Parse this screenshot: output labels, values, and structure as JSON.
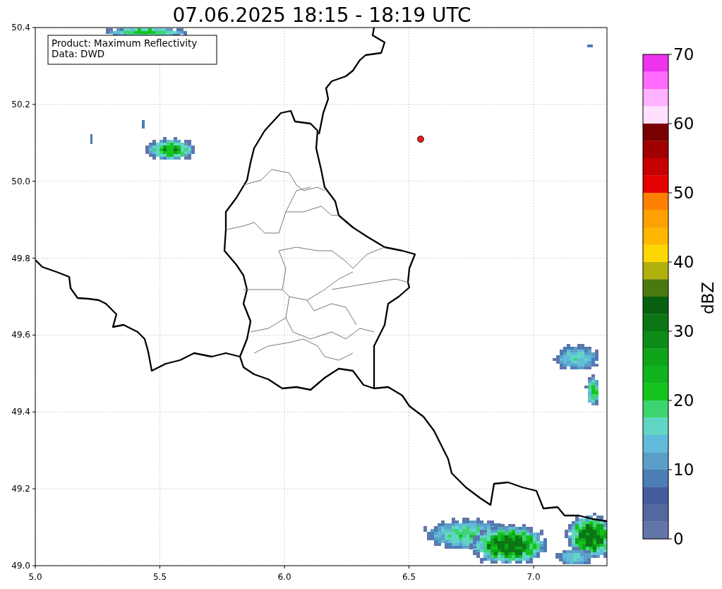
{
  "title": "07.06.2025 18:15 - 18:19 UTC",
  "info_box": {
    "lines": [
      "Product: Maximum Reflectivity",
      "Data: DWD"
    ]
  },
  "map": {
    "xticks": [
      "5.0",
      "5.5",
      "6.0",
      "6.5",
      "7.0"
    ],
    "yticks": [
      "50.4",
      "50.2",
      "50.0",
      "49.8",
      "49.6",
      "49.4",
      "49.2",
      "49.0"
    ]
  },
  "colorbar": {
    "label": "dBZ",
    "ticks": [
      "70",
      "60",
      "50",
      "40",
      "30",
      "20",
      "10",
      "0"
    ],
    "bands": [
      {
        "color": "#ee33ee"
      },
      {
        "color": "#ff6aff"
      },
      {
        "color": "#ffb2ff"
      },
      {
        "color": "#ffe0ff"
      },
      {
        "color": "#7a0000"
      },
      {
        "color": "#a00000"
      },
      {
        "color": "#c40000"
      },
      {
        "color": "#e40000"
      },
      {
        "color": "#ff8000"
      },
      {
        "color": "#ff9f00"
      },
      {
        "color": "#ffb700"
      },
      {
        "color": "#ffd700"
      },
      {
        "color": "#b0b00c"
      },
      {
        "color": "#4a7a0e"
      },
      {
        "color": "#085f10"
      },
      {
        "color": "#0b7614"
      },
      {
        "color": "#0c8c16"
      },
      {
        "color": "#0ea41a"
      },
      {
        "color": "#10b41c"
      },
      {
        "color": "#14c41c"
      },
      {
        "color": "#3ed471"
      },
      {
        "color": "#62d6c6"
      },
      {
        "color": "#62bbda"
      },
      {
        "color": "#5b9fc9"
      },
      {
        "color": "#4c7db4"
      },
      {
        "color": "#435c9e"
      },
      {
        "color": "#5468a0"
      },
      {
        "color": "#6374a8"
      }
    ]
  }
}
